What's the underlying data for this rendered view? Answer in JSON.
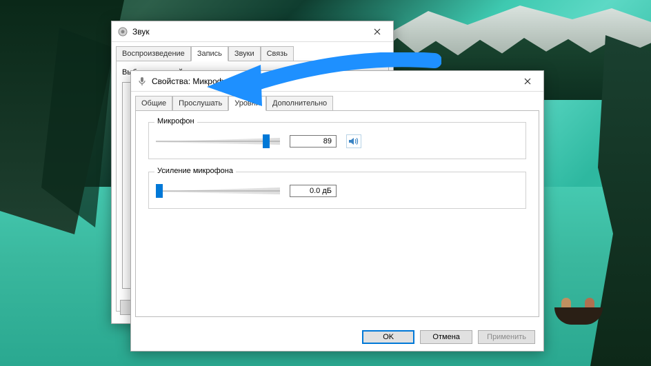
{
  "sound_window": {
    "title": "Звук",
    "tabs": [
      "Воспроизведение",
      "Запись",
      "Звуки",
      "Связь"
    ],
    "active_tab_index": 1,
    "instruction": "Выберите устройство записи, параметры которого нужно изменить:"
  },
  "props_window": {
    "title": "Свойства: Микрофон",
    "tabs": [
      "Общие",
      "Прослушать",
      "Уровни",
      "Дополнительно"
    ],
    "active_tab_index": 2,
    "sections": {
      "microphone": {
        "label": "Микрофон",
        "value": "89",
        "slider_percent": 89
      },
      "boost": {
        "label": "Усиление микрофона",
        "value": "0.0 дБ",
        "slider_percent": 0
      }
    },
    "buttons": {
      "ok": "OK",
      "cancel": "Отмена",
      "apply": "Применить"
    }
  }
}
